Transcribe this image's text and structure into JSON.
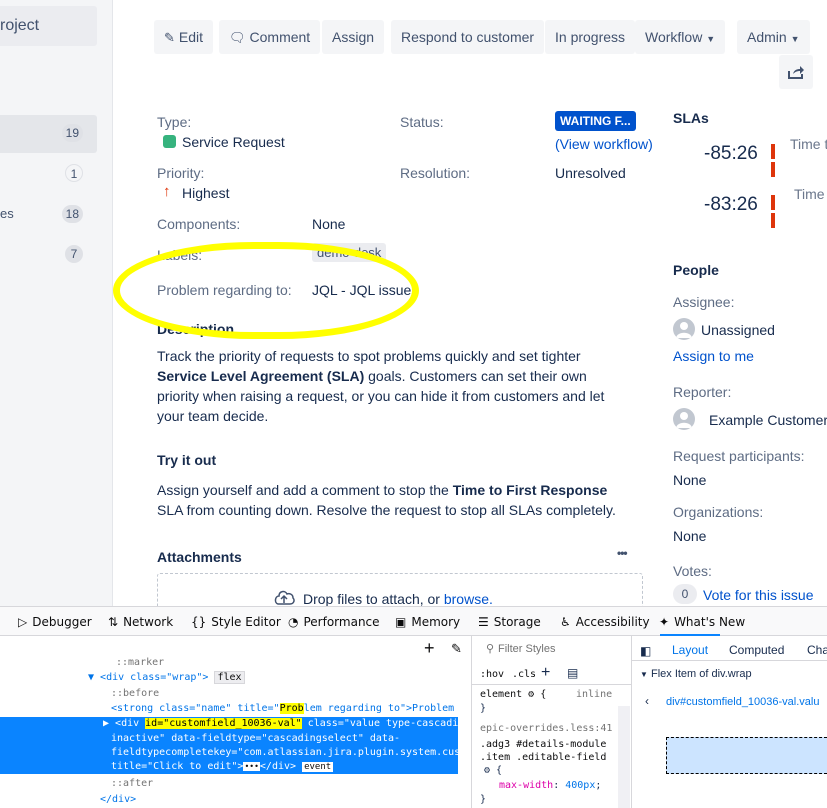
{
  "sidebar": {
    "project_label": "roject",
    "queues": [
      {
        "label": "",
        "count": "19",
        "active": true
      },
      {
        "label": "",
        "count": "1"
      },
      {
        "label": "es",
        "count": "18"
      },
      {
        "label": "",
        "count": "7"
      }
    ]
  },
  "toolbar": {
    "edit": "Edit",
    "comment": "Comment",
    "assign": "Assign",
    "respond": "Respond to customer",
    "in_progress": "In progress",
    "workflow": "Workflow",
    "admin": "Admin"
  },
  "details": {
    "type_label": "Type:",
    "type_value": "Service Request",
    "status_label": "Status:",
    "status_value": "WAITING F...",
    "view_workflow": "(View workflow)",
    "priority_label": "Priority:",
    "priority_value": "Highest",
    "resolution_label": "Resolution:",
    "resolution_value": "Unresolved",
    "components_label": "Components:",
    "components_value": "None",
    "labels_label": "Labels:",
    "labels_value": "demo-desk",
    "problem_label": "Problem regarding to:",
    "problem_value": "JQL - JQL issues"
  },
  "description": {
    "heading": "Description",
    "p1_a": "Track the priority of requests to spot problems quickly and set tighter",
    "p1_b_bold": "Service Level Agreement (SLA)",
    "p1_b_rest": " goals. Customers can set their own",
    "p1_c": "priority when raising a request, or you can hide it from customers and let",
    "p1_d": "your team decide.",
    "try_heading": "Try it out",
    "p2_a_pre": "Assign yourself and add a comment to stop the ",
    "p2_a_bold": "Time to First Response",
    "p2_b": "SLA from counting down. Resolve the request to stop all SLAs completely."
  },
  "attachments": {
    "heading": "Attachments",
    "more": "•••",
    "drop_text": "Drop files to attach, or ",
    "browse": "browse."
  },
  "slas": {
    "heading": "SLAs",
    "items": [
      {
        "time": "-85:26",
        "label": "Time to f"
      },
      {
        "time": "-83:26",
        "label": "Time"
      }
    ]
  },
  "people": {
    "heading": "People",
    "assignee_label": "Assignee:",
    "assignee_value": "Unassigned",
    "assign_to_me": "Assign to me",
    "reporter_label": "Reporter:",
    "reporter_value": "Example Customer",
    "participants_label": "Request participants:",
    "participants_value": "None",
    "organizations_label": "Organizations:",
    "organizations_value": "None",
    "votes_label": "Votes:",
    "votes_count": "0",
    "vote_link": "Vote for this issue"
  },
  "devtools": {
    "tabs": [
      "Debugger",
      "Network",
      "Style Editor",
      "Performance",
      "Memory",
      "Storage",
      "Accessibility",
      "What's New"
    ],
    "filter_placeholder": "Filter Styles",
    "hov": ":hov",
    "cls": ".cls",
    "layout_tabs": [
      "Layout",
      "Computed",
      "Cha"
    ],
    "flex_item": "Flex Item of div.wrap",
    "breadcrumb": "div#customfield_10036-val.valu",
    "tree": {
      "marker": "::marker",
      "wrap_open": "<div class=\"wrap\">",
      "flex_badge": "flex",
      "before": "::before",
      "strong_pre": "<strong class=\"name\" title=\"",
      "strong_hl": "Prob",
      "strong_mid": "lem regarding to\">Problem",
      "sel1_pre": "<div ",
      "sel1_id": "id=\"customfield_10036-val\"",
      "sel1_rest": " class=\"value type-cascadin",
      "sel2": "inactive\" data-fieldtype=\"cascadingselect\" data-",
      "sel3": "fieldtypecompletekey=\"com.atlassian.jira.plugin.system.cus",
      "sel4_pre": "title=\"Click to edit\">",
      "sel4_ellipsis": "•••",
      "sel4_post": "</div>",
      "event_badge": "event",
      "after": "::after",
      "close": "</div>"
    },
    "rules": {
      "element": "element",
      "element_brace": "{",
      "inline": "inline",
      "close": "}",
      "source": "epic-overrides.less:41",
      "selector1": ".adg3 #details-module",
      "selector2": ".item .editable-field",
      "brace": "{",
      "prop": "max-width",
      "value": "400px",
      "close2": "}"
    }
  }
}
